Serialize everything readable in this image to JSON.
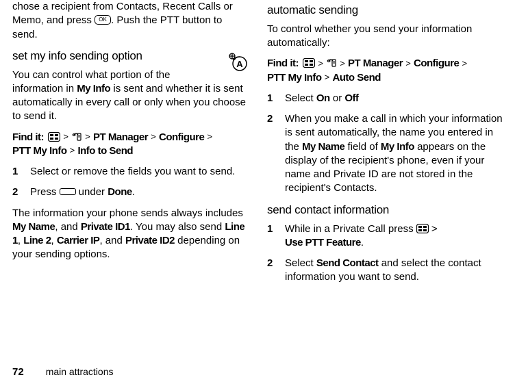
{
  "col1": {
    "introTail": "chose a recipient from Contacts, Recent Calls or Memo, and press ",
    "introTail2": ". Push the PTT button to send.",
    "heading1": "set my info sending option",
    "p1a": "You can control what portion of the information in ",
    "myInfo": "My Info",
    "p1b": " is sent and whether it is sent automatically in every call or only when you choose to send it.",
    "findIt": "Find it:",
    "nav1_ptm": "PT Manager",
    "nav1_cfg": "Configure",
    "nav1_pmi": "PTT My Info",
    "nav1_its": "Info to Send",
    "step1_num": "1",
    "step1": "Select or remove the fields you want to send.",
    "step2_num": "2",
    "step2a": "Press ",
    "step2b": " under ",
    "done": "Done",
    "p2a": "The information your phone sends always includes ",
    "myName": "My Name",
    "p2b": ", and ",
    "pid1": "Private ID1",
    "p2c": ". You may also send ",
    "line1": "Line 1",
    "line2": "Line 2",
    "carrierIP": "Carrier IP",
    "p2d": ", and ",
    "pid2": "Private ID2",
    "p2e": " depending on your sending options."
  },
  "col2": {
    "heading1": "automatic sending",
    "p1": "To control whether you send your information automatically:",
    "findIt": "Find it:",
    "nav_ptm": "PT Manager",
    "nav_cfg": "Configure",
    "nav_pmi": "PTT My Info",
    "nav_as": "Auto Send",
    "s1_num": "1",
    "s1a": "Select ",
    "on": "On",
    "s1b": " or ",
    "off": "Off",
    "s2_num": "2",
    "s2a": "When you make a call in which your information is sent automatically, the name you entered in the ",
    "myNameField": "My Name",
    "s2b": " field of ",
    "myInfo": "My Info",
    "s2c": " appears on the display of the recipient's phone, even if your name and Private ID are not stored in the recipient's Contacts.",
    "heading2": "send contact information",
    "c1_num": "1",
    "c1a": "While in a Private Call press ",
    "c1b": " > ",
    "usePtt": "Use PTT Feature",
    "c2_num": "2",
    "c2a": "Select ",
    "sendContact": "Send Contact",
    "c2b": " and select the contact information you want to send."
  },
  "footer": {
    "page": "72",
    "label": "main attractions"
  },
  "glyph": {
    "ok": "OK",
    "gt": ">"
  }
}
